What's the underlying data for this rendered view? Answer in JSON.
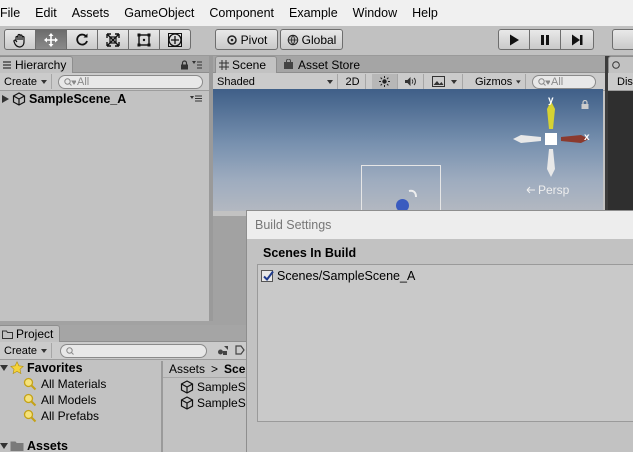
{
  "menu": [
    "File",
    "Edit",
    "Assets",
    "GameObject",
    "Component",
    "Example",
    "Window",
    "Help"
  ],
  "toolbar": {
    "tools": [
      "hand-tool",
      "move-tool",
      "rotate-tool",
      "scale-tool",
      "rect-tool",
      "transform-tool"
    ],
    "pivot_label": "Pivot",
    "global_label": "Global"
  },
  "hierarchy": {
    "tab_label": "Hierarchy",
    "create_label": "Create",
    "search_placeholder": "All",
    "scene_name": "SampleScene_A"
  },
  "scene": {
    "tab_label": "Scene",
    "asset_store_tab": "Asset Store",
    "shading_mode": "Shaded",
    "mode_2d": "2D",
    "gizmos_label": "Gizmos",
    "search_placeholder": "All",
    "gizmo_x": "x",
    "gizmo_y": "y",
    "projection": "Persp"
  },
  "right_panel": {
    "tab_label_partial": "C",
    "display_partial": "Dis"
  },
  "project": {
    "tab_label": "Project",
    "create_label": "Create",
    "favorites_label": "Favorites",
    "favorites": [
      "All Materials",
      "All Models",
      "All Prefabs"
    ],
    "assets_label": "Assets",
    "breadcrumb_root": "Assets",
    "breadcrumb_sep": ">",
    "breadcrumb_current": "Sce",
    "files": [
      "SampleS",
      "SampleS"
    ]
  },
  "build_settings": {
    "title": "Build Settings",
    "section_label": "Scenes In Build",
    "scenes": [
      {
        "path": "Scenes/SampleScene_A",
        "enabled": true
      }
    ]
  }
}
